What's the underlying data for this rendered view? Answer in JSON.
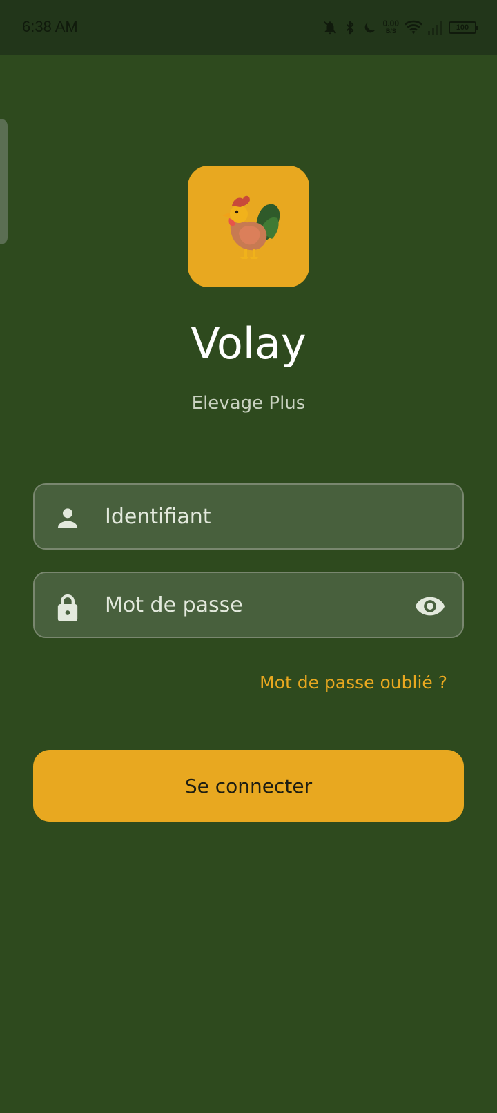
{
  "status_bar": {
    "time": "6:38 AM",
    "net_speed_value": "0.00",
    "net_speed_unit": "B/S",
    "battery_level": "100",
    "icons": [
      "bell-off-icon",
      "bluetooth-icon",
      "moon-icon",
      "wifi-icon",
      "signal-icon",
      "battery-icon"
    ]
  },
  "app": {
    "logo_icon": "rooster-icon",
    "title": "Volay",
    "subtitle": "Elevage Plus"
  },
  "form": {
    "username": {
      "icon": "person-icon",
      "value": "",
      "placeholder": "Identifiant"
    },
    "password": {
      "icon": "lock-icon",
      "value": "",
      "placeholder": "Mot de passe",
      "toggle_icon": "eye-icon"
    },
    "forgot_password": "Mot de passe oublié ?",
    "submit_label": "Se connecter"
  },
  "colors": {
    "background": "#2e4a1e",
    "status_bar": "#22361a",
    "accent": "#e8a820",
    "field_background": "#48603d",
    "field_border": "#79876f",
    "title_text": "#ffffff"
  }
}
